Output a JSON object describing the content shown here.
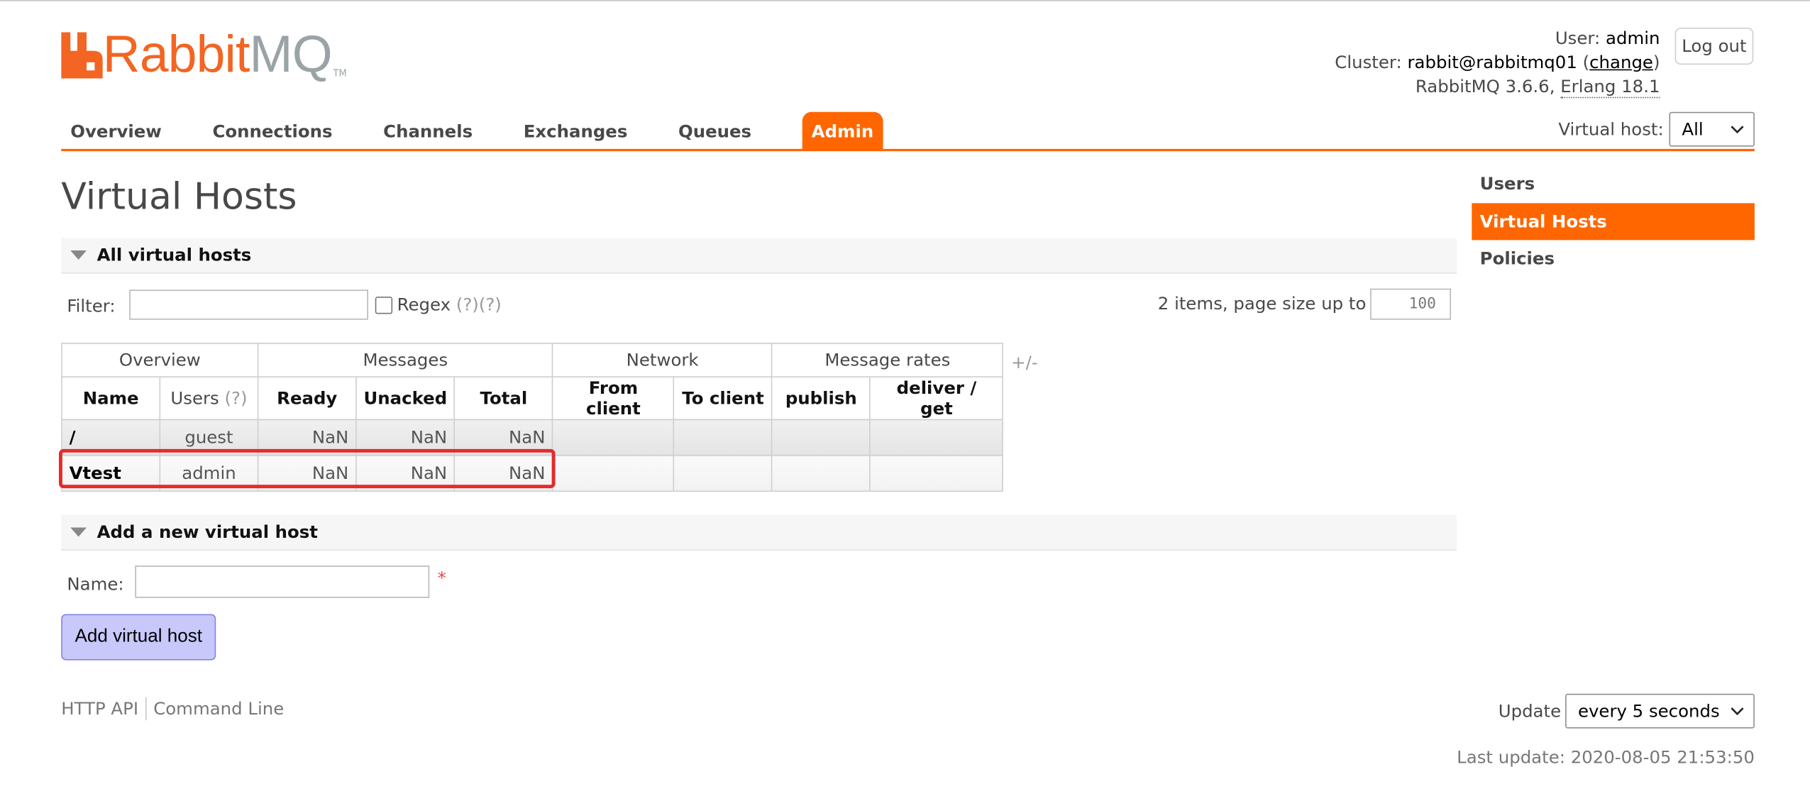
{
  "logo": {
    "rabbit": "Rabbit",
    "mq": "MQ",
    "tm": "TM"
  },
  "header": {
    "user_label": "User:",
    "user": "admin",
    "cluster_label": "Cluster:",
    "cluster": "rabbit@rabbitmq01",
    "change_link": "change",
    "version": "RabbitMQ 3.6.6,",
    "erlang": "Erlang 18.1",
    "logout": "Log out",
    "vhost_label": "Virtual host:",
    "vhost_value": "All"
  },
  "nav": {
    "tabs": [
      "Overview",
      "Connections",
      "Channels",
      "Exchanges",
      "Queues",
      "Admin"
    ],
    "active": "Admin"
  },
  "sidebar": {
    "items": [
      "Users",
      "Virtual Hosts",
      "Policies"
    ],
    "active": "Virtual Hosts"
  },
  "page": {
    "title": "Virtual Hosts"
  },
  "list_section": {
    "title": "All virtual hosts",
    "filter_label": "Filter:",
    "filter_value": "",
    "regex_label": "Regex",
    "help1": "(?)",
    "help2": "(?)",
    "items_text": "2 items, page size up to",
    "page_size": "100",
    "plus_minus": "+/-"
  },
  "table": {
    "groups": [
      "Overview",
      "Messages",
      "Network",
      "Message rates"
    ],
    "columns": {
      "name": "Name",
      "users": "Users",
      "users_help": "(?)",
      "ready": "Ready",
      "unacked": "Unacked",
      "total": "Total",
      "from_client": "From client",
      "to_client": "To client",
      "publish": "publish",
      "deliver_get": "deliver / get"
    },
    "rows": [
      {
        "name": "/",
        "users": "guest",
        "ready": "NaN",
        "unacked": "NaN",
        "total": "NaN",
        "from_client": "",
        "to_client": "",
        "publish": "",
        "deliver_get": ""
      },
      {
        "name": "Vtest",
        "users": "admin",
        "ready": "NaN",
        "unacked": "NaN",
        "total": "NaN",
        "from_client": "",
        "to_client": "",
        "publish": "",
        "deliver_get": ""
      }
    ]
  },
  "add_section": {
    "title": "Add a new virtual host",
    "name_label": "Name:",
    "name_value": "",
    "required": "*",
    "button": "Add virtual host"
  },
  "footer": {
    "http_api": "HTTP API",
    "command_line": "Command Line",
    "update_label": "Update",
    "update_value": "every 5 seconds",
    "last_update": "Last update: 2020-08-05 21:53:50"
  },
  "colors": {
    "accent": "#ff6600",
    "logo_orange": "#f26522",
    "logo_grey": "#9aa3a5",
    "highlight": "#e52a2a",
    "button": "#c8c8fb"
  },
  "icons": {
    "logo": "rabbitmq-logo-icon",
    "select": "chevron-down-icon",
    "section": "triangle-down-icon"
  }
}
